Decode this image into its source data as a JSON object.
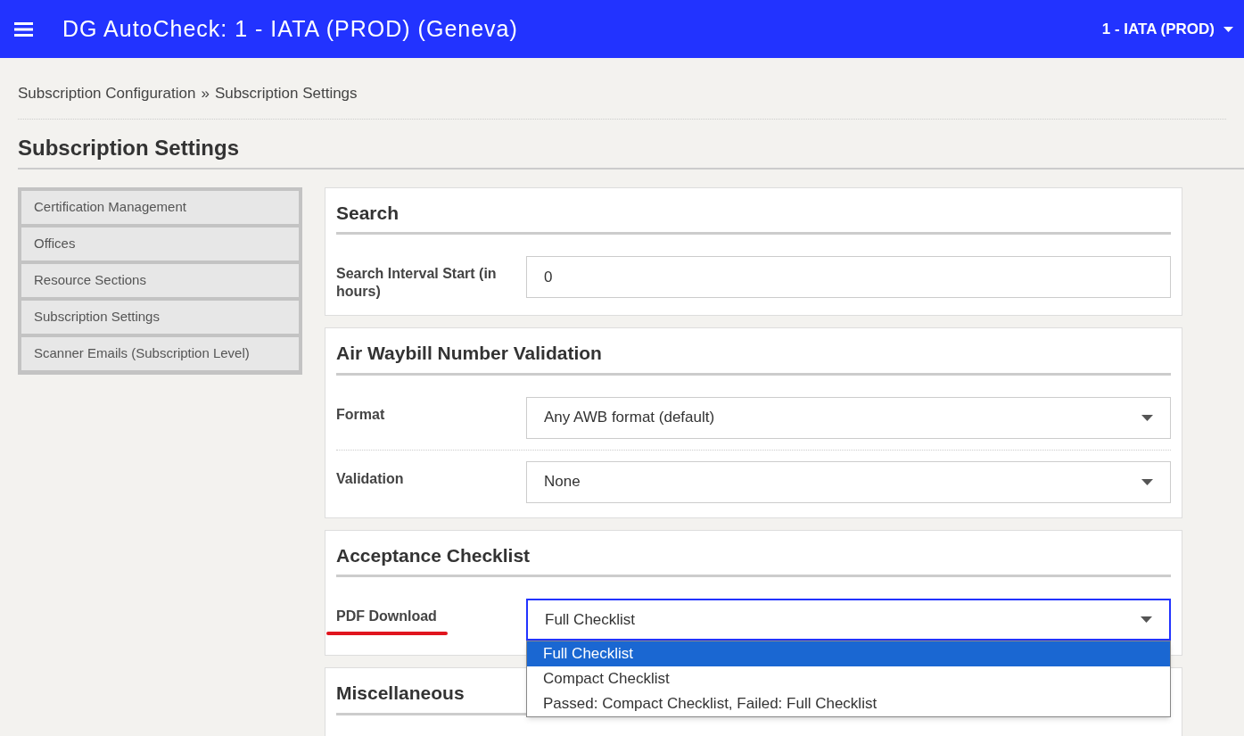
{
  "header": {
    "title": "DG AutoCheck: 1 - IATA (PROD) (Geneva)",
    "account": "1 - IATA (PROD)"
  },
  "breadcrumb": [
    {
      "label": "Subscription Configuration"
    },
    {
      "label": "»"
    },
    {
      "label": "Subscription Settings"
    }
  ],
  "page_title": "Subscription Settings",
  "sidebar": {
    "items": [
      {
        "label": "Certification Management"
      },
      {
        "label": "Offices"
      },
      {
        "label": "Resource Sections"
      },
      {
        "label": "Subscription Settings"
      },
      {
        "label": "Scanner Emails (Subscription Level)"
      }
    ]
  },
  "sections": [
    {
      "title": "Search",
      "fields": [
        {
          "kind": "input",
          "label": "Search Interval Start (in hours)",
          "value": "0"
        }
      ]
    },
    {
      "title": "Air Waybill Number Validation",
      "fields": [
        {
          "kind": "select",
          "label": "Format",
          "value": "Any AWB format (default)",
          "focused": false
        },
        {
          "kind": "select",
          "label": "Validation",
          "value": "None",
          "focused": false
        }
      ]
    },
    {
      "title": "Acceptance Checklist",
      "fields": [
        {
          "kind": "select",
          "label": "PDF Download",
          "value": "Full Checklist",
          "focused": true,
          "underlined": true,
          "options": [
            {
              "label": "Full Checklist",
              "selected": true
            },
            {
              "label": "Compact Checklist",
              "selected": false
            },
            {
              "label": "Passed: Compact Checklist, Failed: Full Checklist",
              "selected": false
            }
          ]
        }
      ]
    },
    {
      "title": "Miscellaneous"
    }
  ]
}
